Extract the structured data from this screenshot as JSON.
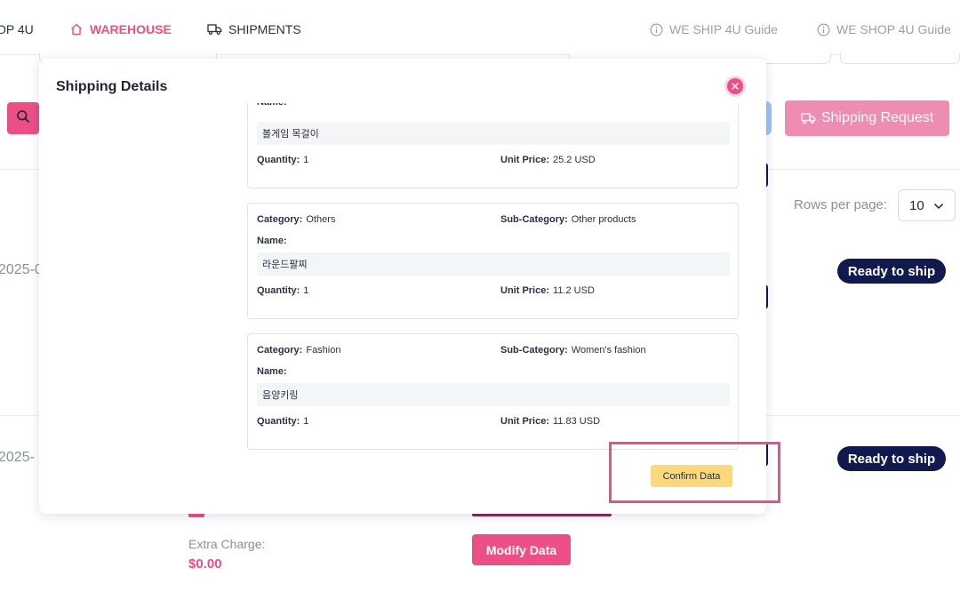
{
  "nav": {
    "cut_label": "OP 4U",
    "warehouse": "WAREHOUSE",
    "shipments": "SHIPMENTS",
    "guide_ship": "WE SHIP 4U Guide",
    "guide_shop": "WE SHOP 4U Guide",
    "active_color": "#ec4f86"
  },
  "page": {
    "shipping_request": "Shipping Request",
    "rows_per_page_label": "Rows per page:",
    "rows_per_page_value": "10",
    "rows": [
      {
        "date": "2025-0",
        "status": "Ready to ship"
      },
      {
        "date": "2025-",
        "status": "Ready to ship"
      }
    ],
    "extra_charge_label": "Extra Charge:",
    "extra_charge_value": "$0.00",
    "modify_data": "Modify Data"
  },
  "modal": {
    "title": "Shipping Details",
    "labels": {
      "category": "Category:",
      "sub_category": "Sub-Category:",
      "name": "Name:",
      "quantity": "Quantity:",
      "unit_price": "Unit Price:"
    },
    "items": [
      {
        "category": "",
        "sub_category": "",
        "name": "볼게임 목걸이",
        "quantity": "1",
        "unit_price": "25.2 USD"
      },
      {
        "category": "Others",
        "sub_category": "Other products",
        "name": "라운드팔찌",
        "quantity": "1",
        "unit_price": "11.2 USD"
      },
      {
        "category": "Fashion",
        "sub_category": "Women's fashion",
        "name": "음양키링",
        "quantity": "1",
        "unit_price": "11.83 USD"
      }
    ],
    "confirm": "Confirm Data"
  },
  "colors": {
    "accent": "#ec4f86",
    "badge": "#101a4e",
    "confirm": "#fbd87c",
    "highlight": "#ec4f86"
  }
}
